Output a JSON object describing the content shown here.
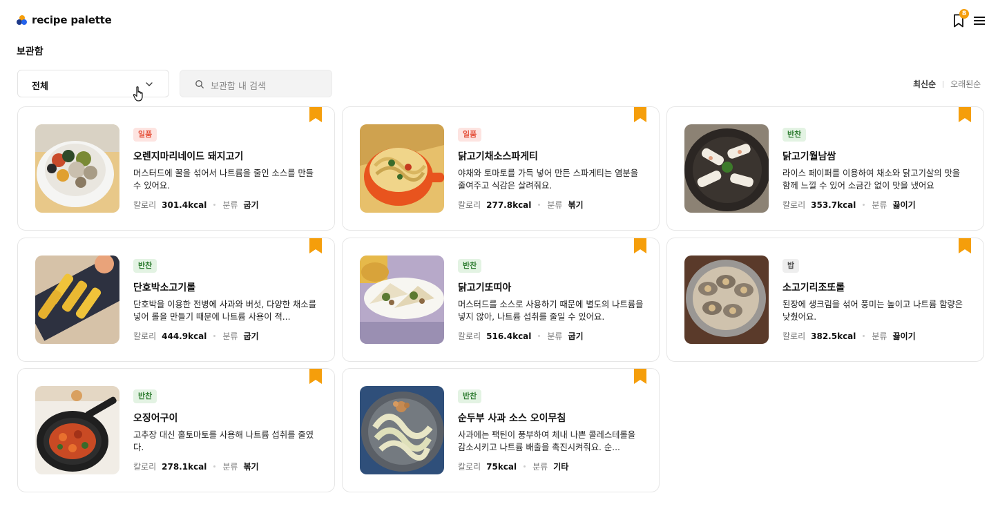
{
  "brand": {
    "name": "recipe palette"
  },
  "header": {
    "bookmark_count": "8"
  },
  "page": {
    "title": "보관함"
  },
  "filter": {
    "selected": "전체"
  },
  "search": {
    "placeholder": "보관함 내 검색"
  },
  "sort": {
    "newest": "최신순",
    "oldest": "오래된순"
  },
  "labels": {
    "calories": "칼로리",
    "category": "분류"
  },
  "colors": {
    "accent": "#f59e0b",
    "tag_red": "#e5533d",
    "tag_green": "#2f7d32",
    "tag_gray": "#555555"
  },
  "recipes": [
    {
      "tag": "일품",
      "title": "오렌지마리네이드 돼지고기",
      "description": "머스터드에 꿀을 섞어서 나트륨을 줄인 소스를 만들 수 있어요.",
      "calories": "301.4kcal",
      "category": "굽기"
    },
    {
      "tag": "일품",
      "title": "닭고기채소스파게티",
      "description": "야채와 토마토를 가득 넣어 만든 스파게티는 염분을 줄여주고 식감은 살려줘요.",
      "calories": "277.8kcal",
      "category": "볶기"
    },
    {
      "tag": "반찬",
      "title": "닭고기월남쌈",
      "description": "라이스 페이퍼를 이용하여 채소와 닭고기살의 맛을 함께 느낄 수 있어 소금간 없이 맛을 냈어요",
      "calories": "353.7kcal",
      "category": "끓이기"
    },
    {
      "tag": "반찬",
      "title": "단호박소고기롤",
      "description": "단호박을 이용한 전병에 사과와 버섯, 다양한 채소를 넣어 롤을 만들기 때문에 나트륨 사용이 적...",
      "calories": "444.9kcal",
      "category": "굽기"
    },
    {
      "tag": "반찬",
      "title": "닭고기또띠아",
      "description": "머스터드를 소스로 사용하기 때문에 별도의 나트륨을 넣지 않아, 나트륨 섭취를 줄일 수 있어요.",
      "calories": "516.4kcal",
      "category": "굽기"
    },
    {
      "tag": "밥",
      "title": "소고기리조또롤",
      "description": "된장에 생크림을 섞어 풍미는 높이고 나트륨 함량은 낮췄어요.",
      "calories": "382.5kcal",
      "category": "끓이기"
    },
    {
      "tag": "반찬",
      "title": "오징어구이",
      "description": "고추장 대신 홀토마토를 사용해 나트륨 섭취를 줄였다.",
      "calories": "278.1kcal",
      "category": "볶기"
    },
    {
      "tag": "반찬",
      "title": "순두부 사과 소스 오이무침",
      "description": "사과에는 팩틴이 풍부하여 체내 나쁜 콜레스테롤을 감소시키고 나트륨 배출을 촉진시켜줘요. 순...",
      "calories": "75kcal",
      "category": "기타"
    }
  ]
}
